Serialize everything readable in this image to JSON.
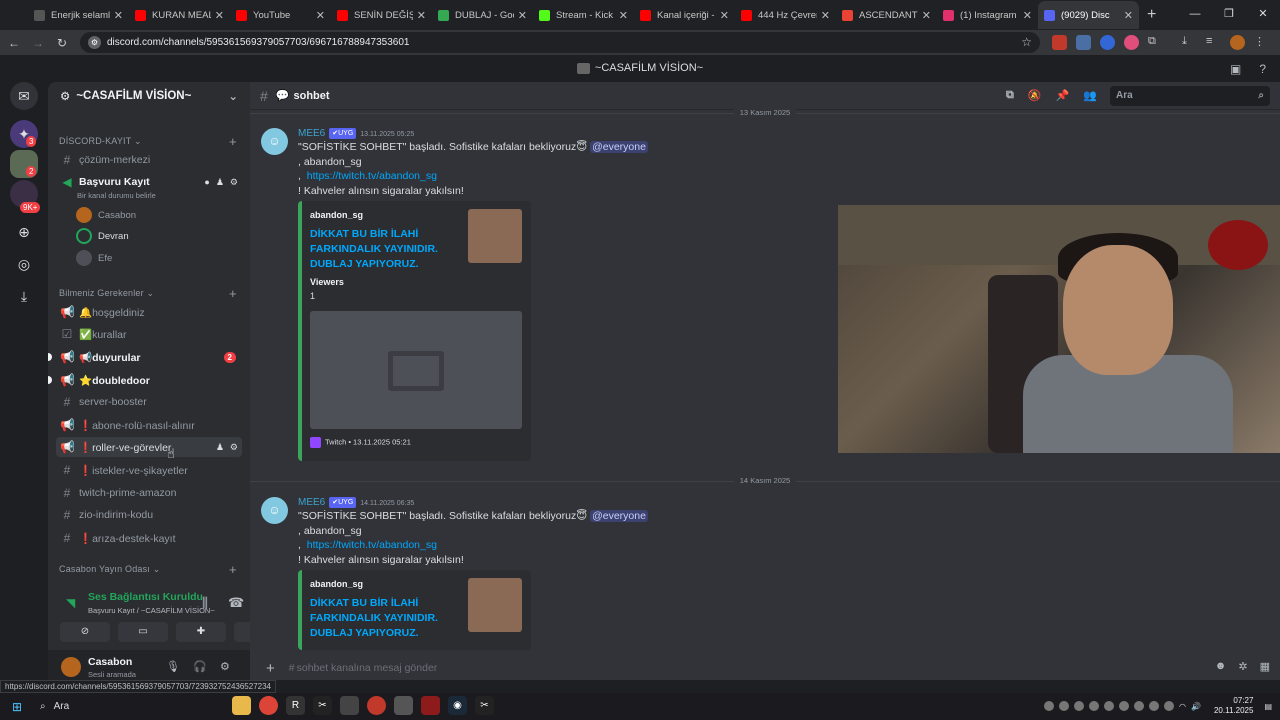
{
  "browser": {
    "tabs": [
      {
        "title": "Enerjik selamla",
        "color": "#555"
      },
      {
        "title": "KURAN MEALİ",
        "color": "#ff0000"
      },
      {
        "title": "YouTube",
        "color": "#ff0000"
      },
      {
        "title": "SENİN DEĞİŞİM",
        "color": "#ff0000"
      },
      {
        "title": "DUBLAJ - Goo",
        "color": "#34a853"
      },
      {
        "title": "Stream - Kick",
        "color": "#53fc18"
      },
      {
        "title": "Kanal içeriği - Y",
        "color": "#ff0000"
      },
      {
        "title": "444 Hz Çevren",
        "color": "#ff0000"
      },
      {
        "title": "ASCENDANT C",
        "color": "#ea4335"
      },
      {
        "title": "(1) Instagram",
        "color": "#e1306c"
      },
      {
        "title": "(9029) Disc",
        "color": "#5865f2"
      }
    ],
    "url": "discord.com/channels/595361569379057703/696716788947353601",
    "status_url": "https://discord.com/channels/595361569379057703/723932752436527234"
  },
  "window_title": "~CASAFİLM VİSİON~",
  "server": {
    "name": "~CASAFİLM VİSİON~",
    "guild_badges": [
      "3",
      "2",
      "9K+"
    ]
  },
  "sidebar": {
    "cat1": "DİSCORD-KAYIT",
    "cat2": "Bilmeniz Gerekenler",
    "cat3": "Casabon Yayın Odası",
    "c_cozum": "çözüm-merkezi",
    "voice": {
      "name": "Başvuru Kayıt",
      "status": "Bir kanal durumu belirle",
      "users": [
        "Casabon",
        "Devran",
        "Efe"
      ]
    },
    "channels": [
      {
        "name": "🔔hoşgeldiniz"
      },
      {
        "name": "✅kurallar"
      },
      {
        "name": "📢duyurular",
        "badge": "2"
      },
      {
        "name": "⭐doubledoor"
      },
      {
        "name": "server-booster"
      },
      {
        "name": "❗abone-rolü-nasıl-alınır"
      },
      {
        "name": "❗roller-ve-görevler"
      },
      {
        "name": "❗istekler-ve-şikayetler"
      },
      {
        "name": "twitch-prime-amazon"
      },
      {
        "name": "zio-indirim-kodu"
      },
      {
        "name": "❗arıza-destek-kayıt"
      }
    ]
  },
  "voice_status": {
    "title": "Ses Bağlantısı Kuruldu",
    "sub": "Başvuru Kayıt / ~CASAFİLM VİSİON~"
  },
  "user": {
    "name": "Casabon",
    "status": "Sesli aramada"
  },
  "channel": {
    "name": "sohbet",
    "search_placeholder": "Ara",
    "composer_placeholder": "sohbet kanalına mesaj gönder"
  },
  "dates": {
    "top": "13 Kasım 2025",
    "mid": "14 Kasım 2025"
  },
  "messages": [
    {
      "author": "MEE6",
      "tag": "✔UYG",
      "time": "13.11.2025 05:25",
      "text": "\"SOFİSTİKE SOHBET\" başladı. Sofistike kafaları bekliyoruz😇",
      "mention": "@everyone",
      "l2": ", abandon_sg",
      "l3": "https://twitch.tv/abandon_sg",
      "l4": "! Kahveler alınsın sigaralar yakılsın!",
      "embed": {
        "author": "abandon_sg",
        "title": "DİKKAT BU BİR İLAHİ FARKINDALIK YAYINIDIR. DUBLAJ YAPIYORUZ.",
        "field": "Viewers",
        "value": "1",
        "footer": "Twitch • 13.11.2025 05:21"
      }
    },
    {
      "author": "MEE6",
      "tag": "✔UYG",
      "time": "14.11.2025 06:35",
      "text": "\"SOFİSTİKE SOHBET\" başladı. Sofistike kafaları bekliyoruz😇",
      "mention": "@everyone",
      "l2": ", abandon_sg",
      "l3": "https://twitch.tv/abandon_sg",
      "l4": "! Kahveler alınsın sigaralar yakılsın!",
      "embed": {
        "author": "abandon_sg",
        "title": "DİKKAT BU BİR İLAHİ FARKINDALIK YAYINIDIR. DUBLAJ YAPIYORUZ."
      }
    }
  ],
  "taskbar": {
    "search": "Ara",
    "time": "07:27",
    "date": "20.11.2025"
  }
}
